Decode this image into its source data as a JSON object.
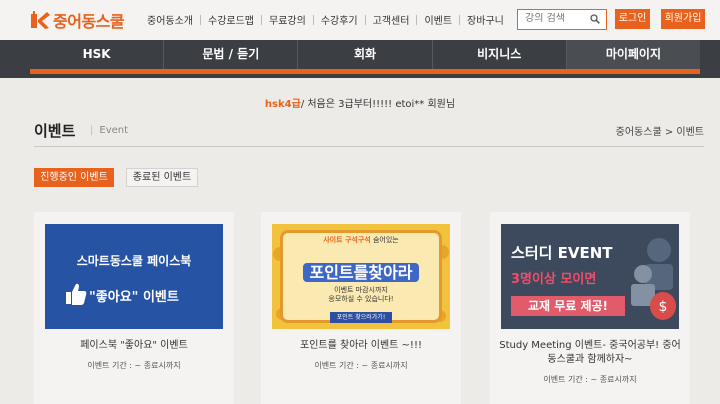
{
  "brand": {
    "logo_text": "중어동스쿨",
    "accent": "#e8621d"
  },
  "topnav": [
    "중어동소개",
    "수강로드맵",
    "무료강의",
    "수강후기",
    "고객센터",
    "이벤트",
    "장바구니"
  ],
  "search": {
    "placeholder": "강의 검색"
  },
  "auth": {
    "login": "로그인",
    "join": "회원가입"
  },
  "mainnav": [
    "HSK",
    "문법 / 듣기",
    "회화",
    "비지니스",
    "마이페이지"
  ],
  "notice": {
    "highlight": "hsk4급",
    "text": "/ 처음은 3급부터!!!!! etoi** 회원님"
  },
  "page": {
    "title": "이벤트",
    "subtitle": "Event",
    "breadcrumb": "중어동스쿨 > 이벤트"
  },
  "filters": {
    "active": "진행중인 이벤트",
    "ended": "종료된 이벤트"
  },
  "cards": [
    {
      "title": "페이스북 \"좋아요\" 이벤트",
      "period": "이벤트 기간 : ~ 종료시까지",
      "banner": {
        "line1": "스마트동스쿨 페이스북",
        "line2": "\"좋아요\" 이벤트"
      }
    },
    {
      "title": "포인트를 찾아라 이벤트 ~!!!",
      "period": "이벤트 기간 : ~ 종료시까지",
      "banner": {
        "top_a": "사이트 구석구석",
        "top_b": " 숨어있는",
        "big": "포인트를찾아라",
        "desc1": "이벤트 마감시까지",
        "desc2": "응모하실 수 있습니다!",
        "button": "포인트 찾으러가기!"
      }
    },
    {
      "title": "Study Meeting 이벤트- 중국어공부! 중어동스쿨과 함께하자~",
      "period": "이벤트 기간 : ~ 종료시까지",
      "banner": {
        "line1": "스터디 EVENT",
        "line2": "3명이상 모이면",
        "line3": "교재 무료 제공!"
      }
    }
  ]
}
